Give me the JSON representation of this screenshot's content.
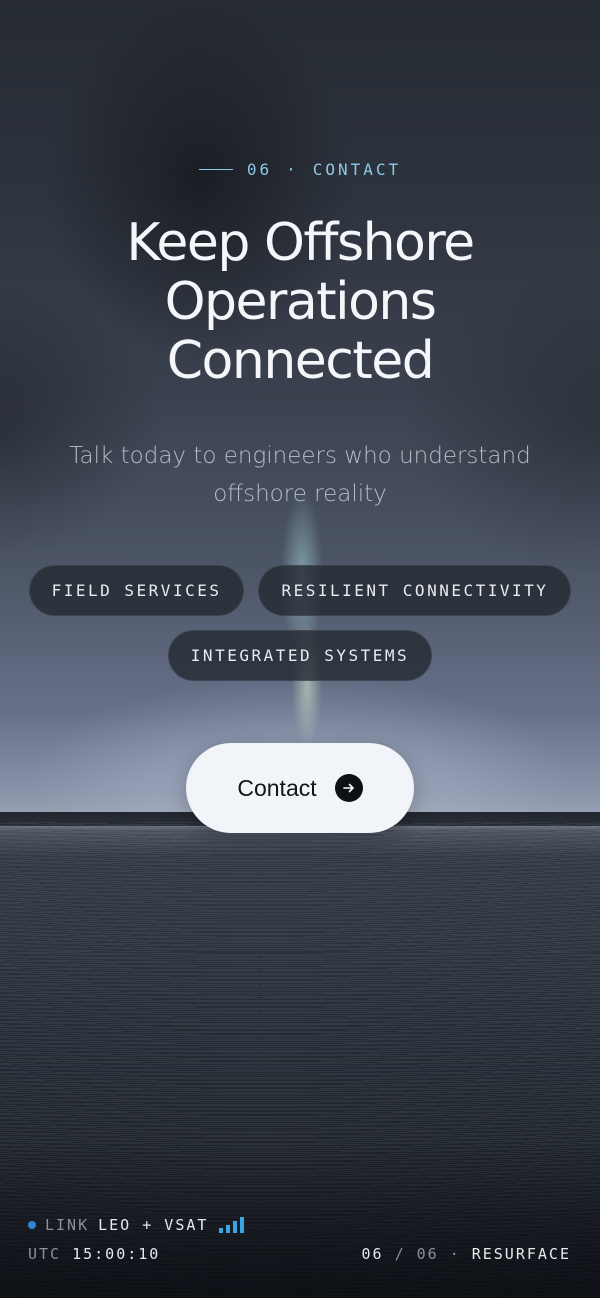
{
  "section": {
    "number": "06",
    "separator": "·",
    "label": "CONTACT"
  },
  "headline": {
    "line1": "Keep Offshore",
    "line2": "Operations",
    "line3": "Connected"
  },
  "subhead": {
    "line1": "Talk today to engineers who understand",
    "line2": "offshore reality"
  },
  "chips": [
    {
      "label": "FIELD SERVICES"
    },
    {
      "label": "RESILIENT CONNECTIVITY"
    },
    {
      "label": "INTEGRATED SYSTEMS"
    }
  ],
  "cta": {
    "label": "Contact",
    "icon": "arrow-right-icon"
  },
  "status": {
    "link_label": "LINK",
    "link_value": "LEO + VSAT",
    "signal_bars": 4,
    "utc_label": "UTC",
    "utc_time": "15:00:10",
    "page_current": "06",
    "page_sep": "/",
    "page_total": "06",
    "dot": "·",
    "action_label": "RESURFACE"
  },
  "colors": {
    "accent": "#8cc8e6",
    "link_dot": "#2f86d6",
    "signal": "#3aa6e0",
    "cta_bg": "#f1f4f9"
  }
}
